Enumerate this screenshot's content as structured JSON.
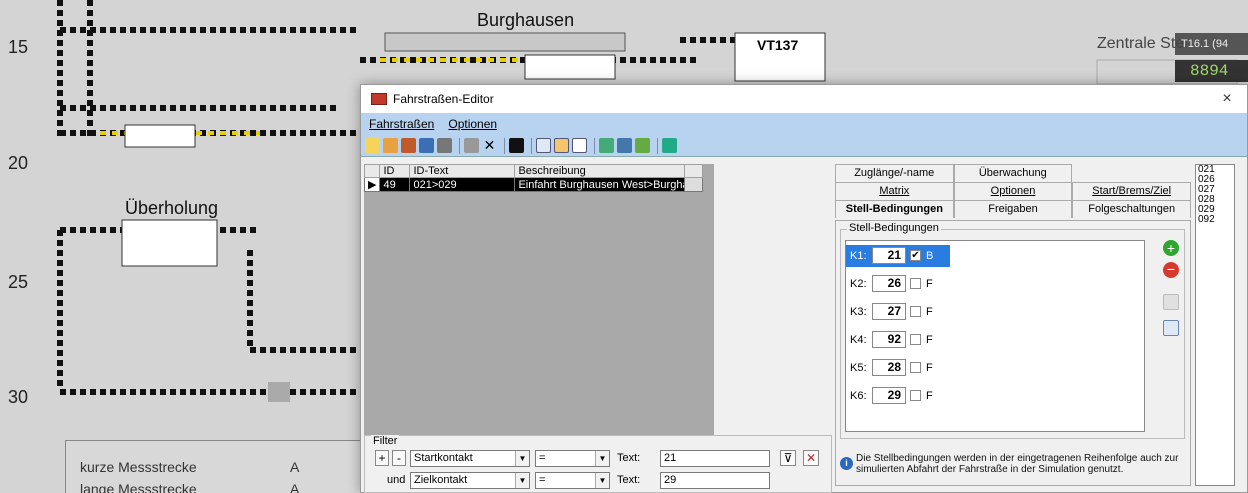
{
  "background": {
    "row_numbers": [
      "15",
      "20",
      "25",
      "30"
    ],
    "titles": {
      "burghausen": "Burghausen",
      "ueberholung": "Überholung",
      "zentrale": "Zentrale Ste"
    },
    "train": "VT137",
    "status_readout": "T16.1 (94",
    "green_readout": "8894",
    "legend": [
      {
        "label": "kurze Messstrecke",
        "value": "A"
      },
      {
        "label": "lange Messstrecke",
        "value": "A"
      }
    ]
  },
  "editor": {
    "title": "Fahrstraßen-Editor",
    "close": "×",
    "menu": [
      "Fahrstraßen",
      "Optionen"
    ],
    "grid": {
      "headers": [
        "ID",
        "ID-Text",
        "Beschreibung"
      ],
      "rows": [
        {
          "id": "49",
          "idtext": "021>029",
          "desc": "Einfahrt Burghausen West>Burghau"
        }
      ]
    },
    "filter": {
      "legend": "Filter",
      "plus": "+",
      "minus": "-",
      "und": "und",
      "row1": {
        "field": "Startkontakt",
        "op": "=",
        "text_label": "Text:",
        "value": "21"
      },
      "row2": {
        "field": "Zielkontakt",
        "op": "=",
        "text_label": "Text:",
        "value": "29"
      }
    },
    "tabs": {
      "row1": [
        "Zuglänge/-name",
        "Überwachung"
      ],
      "row2": [
        "Matrix",
        "Optionen",
        "Start/Brems/Ziel"
      ],
      "row3": [
        "Stell-Bedingungen",
        "Freigaben",
        "Folgeschaltungen"
      ]
    },
    "stell_bedingungen": {
      "group_label": "Stell-Bedingungen",
      "items": [
        {
          "k": "K1:",
          "num": "21",
          "checked": true,
          "flag": "B"
        },
        {
          "k": "K2:",
          "num": "26",
          "checked": false,
          "flag": "F"
        },
        {
          "k": "K3:",
          "num": "27",
          "checked": false,
          "flag": "F"
        },
        {
          "k": "K4:",
          "num": "92",
          "checked": false,
          "flag": "F"
        },
        {
          "k": "K5:",
          "num": "28",
          "checked": false,
          "flag": "F"
        },
        {
          "k": "K6:",
          "num": "29",
          "checked": false,
          "flag": "F"
        }
      ],
      "hint": "Die Stellbedingungen werden in der eingetragenen Reihenfolge auch zur simulierten Abfahrt der Fahrstraße in der Simulation genutzt."
    },
    "kontakt_list": [
      "021",
      "026",
      "027",
      "028",
      "029",
      "092"
    ]
  },
  "colors": {
    "menu_bg": "#b8d3f0",
    "selection": "#2a7de0",
    "add": "#2fa52f",
    "remove": "#d63a2e"
  }
}
